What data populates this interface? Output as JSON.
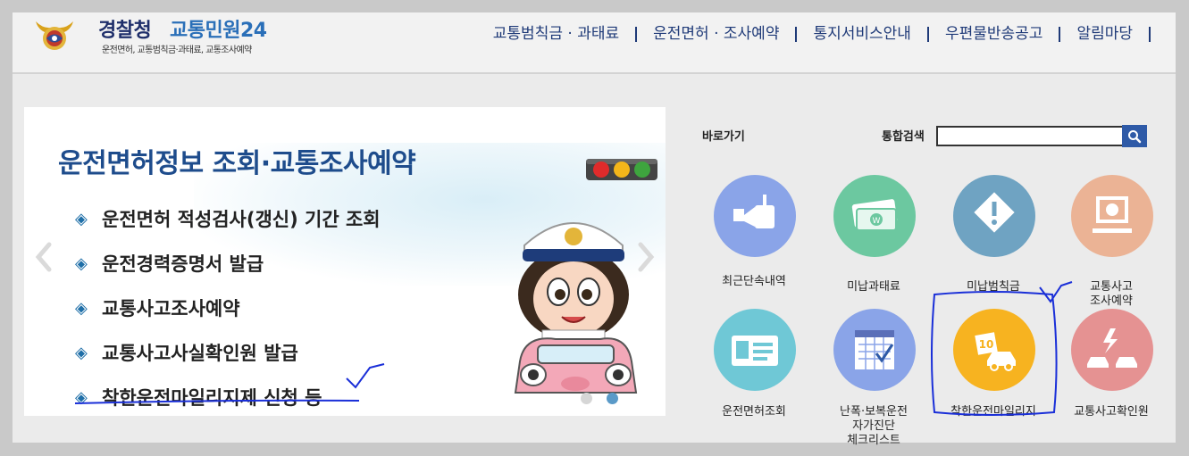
{
  "header": {
    "logo_main": "경찰청",
    "logo_sub": "교통민원24",
    "logo_tagline": "운전면허, 교통범칙금·과태료, 교통조사예약",
    "nav": [
      "교통범칙금 · 과태료",
      "운전면허 · 조사예약",
      "통지서비스안내",
      "우편물반송공고",
      "알림마당"
    ]
  },
  "slider": {
    "title": "운전면허정보 조회·교통조사예약",
    "bullet": "◈",
    "items": [
      "운전면허 적성검사(갱신) 기간 조회",
      "운전경력증명서 발급",
      "교통사고조사예약",
      "교통사고사실확인원 발급",
      "착한운전마일리지제 신청 등"
    ],
    "active_slide": 2,
    "total_slides": 2
  },
  "quick": {
    "shortcut_label": "바로가기",
    "search_label": "통합검색",
    "search_value": "",
    "tiles": [
      {
        "label": "최근단속내역",
        "icon": "camera-icon",
        "color": "#8aa4e8"
      },
      {
        "label": "미납과태료",
        "icon": "money-icon",
        "color": "#6cc8a0"
      },
      {
        "label": "미납범칙금",
        "icon": "warning-sign-icon",
        "color": "#6fa3c2"
      },
      {
        "label": "교통사고\n조사예약",
        "icon": "monitor-icon",
        "color": "#ebb395"
      },
      {
        "label": "운전면허조회",
        "icon": "license-card-icon",
        "color": "#6fc8d6"
      },
      {
        "label": "난폭·보복운전\n자가진단\n체크리스트",
        "icon": "calendar-check-icon",
        "color": "#8aa4e8"
      },
      {
        "label": "착한운전마일리지",
        "icon": "mileage-car-icon",
        "color": "#f7b320"
      },
      {
        "label": "교통사고확인원",
        "icon": "car-crash-icon",
        "color": "#e59292"
      }
    ]
  },
  "colors": {
    "brand_dark": "#1f2f6b",
    "brand_blue": "#2a6fb8",
    "annotation": "#1a2fd8"
  }
}
